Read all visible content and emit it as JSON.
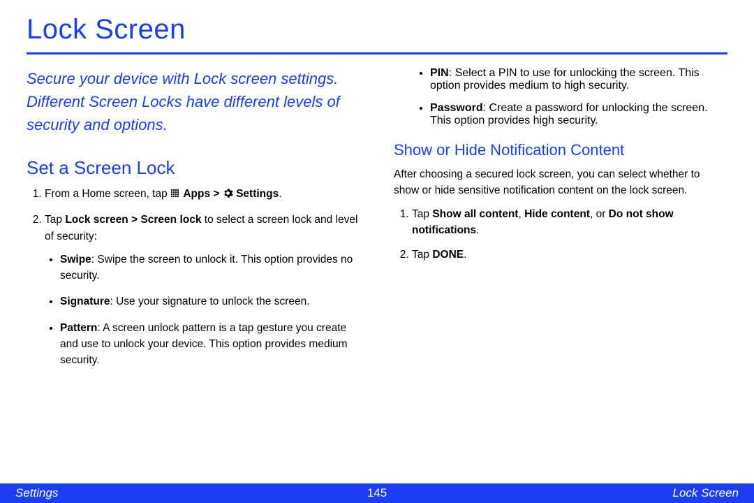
{
  "title": "Lock Screen",
  "intro": "Secure your device with Lock screen settings. Different Screen Locks have different levels of security and options.",
  "leftCol": {
    "heading": "Set a Screen Lock",
    "step1_pre": "From a Home screen, tap ",
    "step1_apps": "Apps > ",
    "step1_settings": "Settings",
    "step1_period": ".",
    "step2_pre": "Tap ",
    "step2_bold": "Lock screen > Screen lock",
    "step2_post": " to select a screen lock and level of security:",
    "bullets": {
      "swipe_label": "Swipe",
      "swipe_text": ": Swipe the screen to unlock it. This option provides no security.",
      "sig_label": "Signature",
      "sig_text": ": Use your signature to unlock the screen.",
      "pattern_label": "Pattern",
      "pattern_text": ": A screen unlock pattern is a tap gesture you create and use to unlock your device. This option provides medium security."
    }
  },
  "rightCol": {
    "bulletsTop": {
      "pin_label": "PIN",
      "pin_text": ": Select a PIN to use for unlocking the screen. This option provides medium to high security.",
      "pwd_label": "Password",
      "pwd_text": ": Create a password for unlocking the screen. This option provides high security."
    },
    "heading": "Show or Hide Notification Content",
    "para": "After choosing a secured lock screen, you can select whether to show or hide sensitive notification content on the lock screen.",
    "step1_pre": "Tap ",
    "step1_b1": "Show all content",
    "step1_c1": ", ",
    "step1_b2": "Hide content",
    "step1_c2": ", or ",
    "step1_b3": "Do not show notifications",
    "step1_period": ".",
    "step2_pre": "Tap ",
    "step2_bold": "DONE",
    "step2_period": "."
  },
  "footer": {
    "left": "Settings",
    "center": "145",
    "right": "Lock Screen"
  }
}
